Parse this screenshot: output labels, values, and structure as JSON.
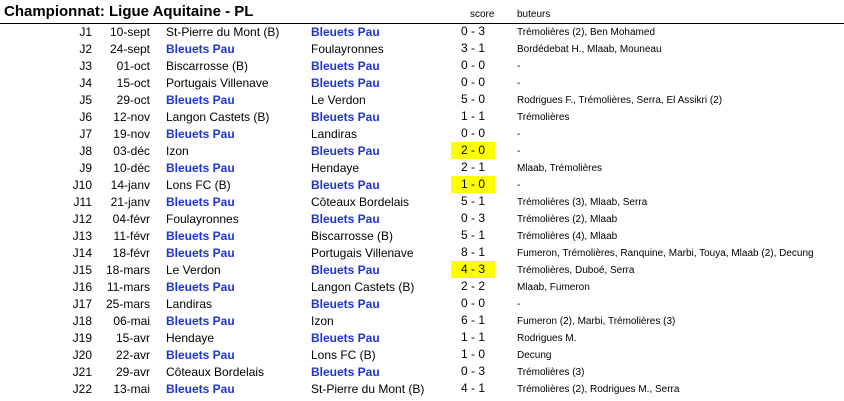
{
  "title": "Championnat: Ligue Aquitaine - PL",
  "headers": {
    "score": "score",
    "scorers": "buteurs"
  },
  "highlight_color": "#ffff00",
  "club_color": "#1f35d1",
  "club": "Bleuets Pau",
  "matches": [
    {
      "round": "J1",
      "date": "10-sept",
      "home": "St-Pierre du Mont (B)",
      "away": "Bleuets Pau",
      "score": "0 - 3",
      "scorers": "Trémolières (2), Ben Mohamed",
      "highlight": false
    },
    {
      "round": "J2",
      "date": "24-sept",
      "home": "Bleuets Pau",
      "away": "Foulayronnes",
      "score": "3 - 1",
      "scorers": "Bordédebat H., Mlaab, Mouneau",
      "highlight": false
    },
    {
      "round": "J3",
      "date": "01-oct",
      "home": "Biscarrosse (B)",
      "away": "Bleuets Pau",
      "score": "0 - 0",
      "scorers": "-",
      "highlight": false
    },
    {
      "round": "J4",
      "date": "15-oct",
      "home": "Portugais Villenave",
      "away": "Bleuets Pau",
      "score": "0 - 0",
      "scorers": "-",
      "highlight": false
    },
    {
      "round": "J5",
      "date": "29-oct",
      "home": "Bleuets Pau",
      "away": "Le Verdon",
      "score": "5 - 0",
      "scorers": "Rodrigues F., Trémolières, Serra, El Assikri (2)",
      "highlight": false
    },
    {
      "round": "J6",
      "date": "12-nov",
      "home": "Langon Castets (B)",
      "away": "Bleuets Pau",
      "score": "1 - 1",
      "scorers": "Trémolières",
      "highlight": false
    },
    {
      "round": "J7",
      "date": "19-nov",
      "home": "Bleuets Pau",
      "away": "Landiras",
      "score": "0 - 0",
      "scorers": "-",
      "highlight": false
    },
    {
      "round": "J8",
      "date": "03-déc",
      "home": "Izon",
      "away": "Bleuets Pau",
      "score": "2 - 0",
      "scorers": "-",
      "highlight": true
    },
    {
      "round": "J9",
      "date": "10-déc",
      "home": "Bleuets Pau",
      "away": "Hendaye",
      "score": "2 - 1",
      "scorers": "Mlaab, Trémolières",
      "highlight": false
    },
    {
      "round": "J10",
      "date": "14-janv",
      "home": "Lons FC (B)",
      "away": "Bleuets Pau",
      "score": "1 - 0",
      "scorers": "-",
      "highlight": true
    },
    {
      "round": "J11",
      "date": "21-janv",
      "home": "Bleuets Pau",
      "away": "Côteaux Bordelais",
      "score": "5 - 1",
      "scorers": "Trémolières (3), Mlaab, Serra",
      "highlight": false
    },
    {
      "round": "J12",
      "date": "04-févr",
      "home": "Foulayronnes",
      "away": "Bleuets Pau",
      "score": "0 - 3",
      "scorers": "Trémolières (2), Mlaab",
      "highlight": false
    },
    {
      "round": "J13",
      "date": "11-févr",
      "home": "Bleuets Pau",
      "away": "Biscarrosse (B)",
      "score": "5 - 1",
      "scorers": "Trémolières (4), Mlaab",
      "highlight": false
    },
    {
      "round": "J14",
      "date": "18-févr",
      "home": "Bleuets Pau",
      "away": "Portugais Villenave",
      "score": "8 - 1",
      "scorers": "Fumeron, Trémolières, Ranquine, Marbi, Touya, Mlaab (2), Decung",
      "highlight": false
    },
    {
      "round": "J15",
      "date": "18-mars",
      "home": "Le Verdon",
      "away": "Bleuets Pau",
      "score": "4 - 3",
      "scorers": "Trémolières, Duboé, Serra",
      "highlight": true
    },
    {
      "round": "J16",
      "date": "11-mars",
      "home": "Bleuets Pau",
      "away": "Langon Castets (B)",
      "score": "2 - 2",
      "scorers": "Mlaab, Fumeron",
      "highlight": false
    },
    {
      "round": "J17",
      "date": "25-mars",
      "home": "Landiras",
      "away": "Bleuets Pau",
      "score": "0 - 0",
      "scorers": "-",
      "highlight": false
    },
    {
      "round": "J18",
      "date": "06-mai",
      "home": "Bleuets Pau",
      "away": "Izon",
      "score": "6 - 1",
      "scorers": "Fumeron (2), Marbi, Trémolières (3)",
      "highlight": false
    },
    {
      "round": "J19",
      "date": "15-avr",
      "home": "Hendaye",
      "away": "Bleuets Pau",
      "score": "1 - 1",
      "scorers": "Rodrigues M.",
      "highlight": false
    },
    {
      "round": "J20",
      "date": "22-avr",
      "home": "Bleuets Pau",
      "away": "Lons FC (B)",
      "score": "1 - 0",
      "scorers": "Decung",
      "highlight": false
    },
    {
      "round": "J21",
      "date": "29-avr",
      "home": "Côteaux Bordelais",
      "away": "Bleuets Pau",
      "score": "0 - 3",
      "scorers": "Trémolières (3)",
      "highlight": false
    },
    {
      "round": "J22",
      "date": "13-mai",
      "home": "Bleuets Pau",
      "away": "St-Pierre du Mont (B)",
      "score": "4 - 1",
      "scorers": "Trémolières (2), Rodrigues M., Serra",
      "highlight": false
    }
  ]
}
